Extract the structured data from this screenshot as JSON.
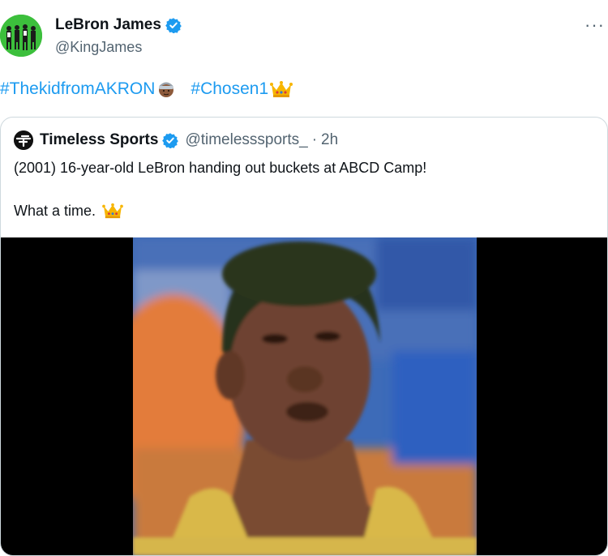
{
  "author": {
    "name": "LeBron James",
    "handle": "@KingJames"
  },
  "tweet": {
    "hashtag1": "#ThekidfromAKRON",
    "hashtag2": "#Chosen1"
  },
  "quote": {
    "name": "Timeless Sports",
    "handle": "@timelesssports_",
    "separator": "·",
    "time": "2h",
    "line1": "(2001) 16-year-old LeBron handing out buckets at ABCD Camp!",
    "line2": "What a time."
  },
  "icons": {
    "more": "more-options-icon",
    "verified": "verified-badge-icon",
    "crown": "crown-emoji-icon",
    "person": "person-emoji-icon"
  },
  "colors": {
    "link": "#1d9bf0",
    "verified": "#1d9bf0",
    "secondary_text": "#536471",
    "border": "#cfd9de"
  }
}
